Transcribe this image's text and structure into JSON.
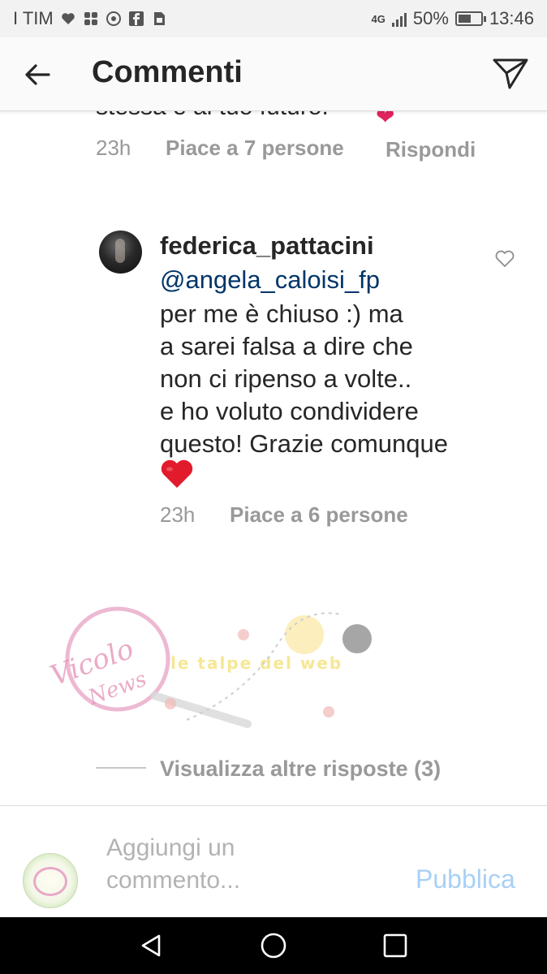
{
  "status_bar": {
    "carrier": "I TIM",
    "network": "4G",
    "battery": "50%",
    "time": "13:46"
  },
  "header": {
    "title": "Commenti"
  },
  "previous_comment": {
    "text_fragment": "stessa e al tuo futuro.",
    "time": "23h",
    "likes": "Piace a 7 persone",
    "reply_label": "Rispondi"
  },
  "comment": {
    "username": "federica_pattacini",
    "mention": "@angela_caloisi_fp",
    "text": "per me è chiuso :) ma\na sarei falsa a dire che\nnon ci ripenso a volte..\ne ho voluto condividere\nquesto! Grazie comunque",
    "emoji": "❤️",
    "time": "23h",
    "likes": "Piace a 6 persone"
  },
  "watermark": {
    "logo_text": "Vicolo delle News",
    "tagline": "le talpe del web"
  },
  "more_replies": "Visualizza altre risposte (3)",
  "composer": {
    "placeholder": "Aggiungi un\ncommento...",
    "publish_label": "Pubblica"
  },
  "colors": {
    "mention": "#003569",
    "muted": "#999999",
    "publish_disabled": "#a9d0f5",
    "heart": "#e0245e"
  }
}
